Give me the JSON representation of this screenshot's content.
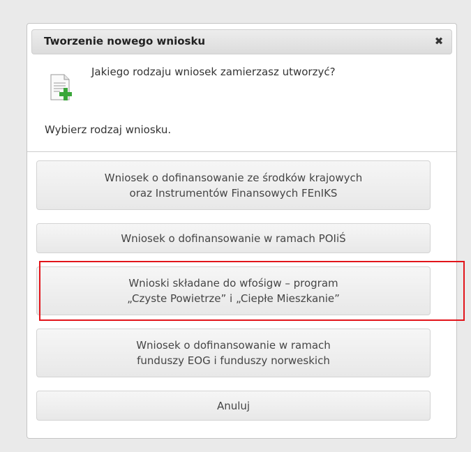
{
  "dialog": {
    "title": "Tworzenie nowego wniosku",
    "close_symbol": "✖",
    "question": "Jakiego rodzaju wniosek zamierzasz utworzyć?",
    "instruction": "Wybierz rodzaj wniosku.",
    "icon": "document-add-icon",
    "buttons": [
      {
        "line1": "Wniosek o dofinansowanie ze środków krajowych",
        "line2": "oraz Instrumentów Finansowych FEnIKS"
      },
      {
        "line1": "Wniosek o dofinansowanie w ramach POIiŚ"
      },
      {
        "line1": "Wnioski składane do wfośigw – program",
        "line2": "„Czyste Powietrze” i „Ciepłe Mieszkanie”"
      },
      {
        "line1": "Wniosek o dofinansowanie w ramach",
        "line2": "funduszy EOG i funduszy norweskich"
      },
      {
        "line1": "Anuluj"
      }
    ]
  },
  "colors": {
    "highlight": "#e2141a",
    "icon_plus": "#3aa63a",
    "background": "#eaeaea"
  }
}
